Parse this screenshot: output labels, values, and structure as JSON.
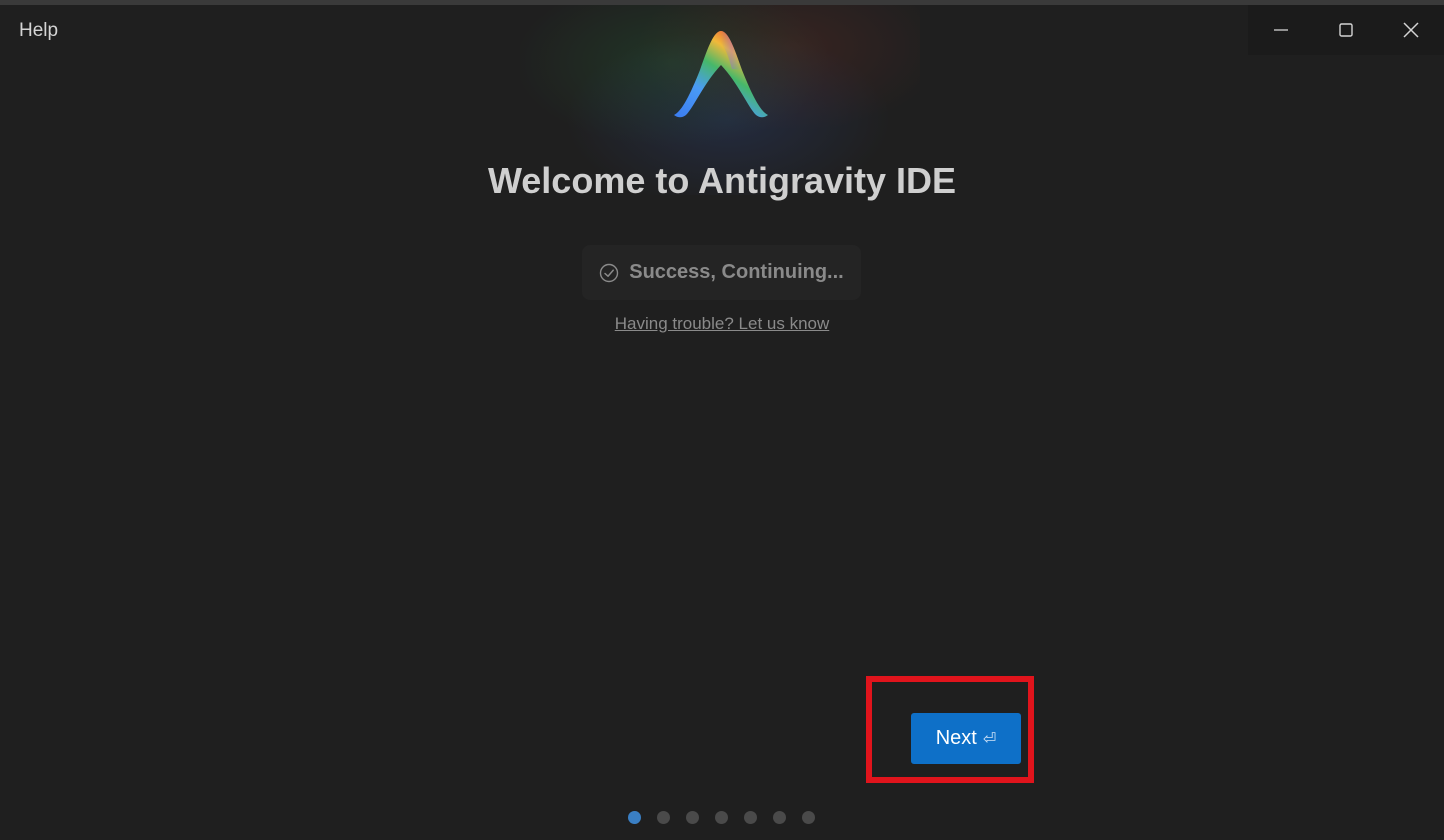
{
  "menu": {
    "help_label": "Help"
  },
  "window_controls": {
    "minimize_icon": "minimize-icon",
    "maximize_icon": "maximize-icon",
    "close_icon": "close-icon"
  },
  "welcome": {
    "title": "Welcome to Antigravity IDE",
    "status_icon": "check-circle-icon",
    "status_text": "Success, Continuing...",
    "help_link": "Having trouble? Let us know"
  },
  "actions": {
    "next_label": "Next",
    "next_icon": "⏎"
  },
  "pagination": {
    "total_steps": 7,
    "current_step": 1
  },
  "colors": {
    "accent": "#0e70c8",
    "highlight_border": "#e0141c",
    "background": "#1f1f1f"
  }
}
